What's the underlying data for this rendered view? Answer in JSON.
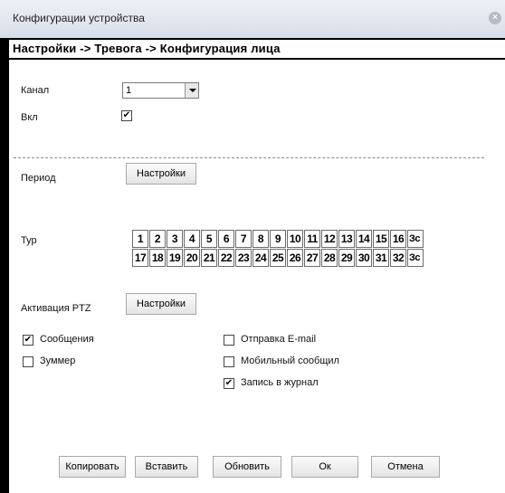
{
  "window": {
    "title": "Конфигурации устройства",
    "close_icon": "close-icon"
  },
  "breadcrumb": "Настройки -> Тревога -> Конфигурация лица",
  "channel": {
    "label": "Канал",
    "value": "1"
  },
  "enable": {
    "label": "Вкл",
    "checked": true
  },
  "period": {
    "label": "Период",
    "button": "Настройки"
  },
  "tour": {
    "label": "Тур",
    "row1": [
      "1",
      "2",
      "3",
      "4",
      "5",
      "6",
      "7",
      "8",
      "9",
      "10",
      "11",
      "12",
      "13",
      "14",
      "15",
      "16",
      "Зс"
    ],
    "row2": [
      "17",
      "18",
      "19",
      "20",
      "21",
      "22",
      "23",
      "24",
      "25",
      "26",
      "27",
      "28",
      "29",
      "30",
      "31",
      "32",
      "Зс"
    ]
  },
  "ptz": {
    "label": "Активация PTZ",
    "button": "Настройки"
  },
  "options": {
    "messages": {
      "label": "Сообщения",
      "checked": true
    },
    "buzzer": {
      "label": "Зуммер",
      "checked": false
    },
    "email": {
      "label": "Отправка E-mail",
      "checked": false
    },
    "mobile": {
      "label": "Мобильный сообщил",
      "checked": false
    },
    "log": {
      "label": "Запись в журнал",
      "checked": true
    }
  },
  "footer": {
    "copy": "Копировать",
    "paste": "Вставить",
    "refresh": "Обновить",
    "ok": "Ок",
    "cancel": "Отмена"
  }
}
